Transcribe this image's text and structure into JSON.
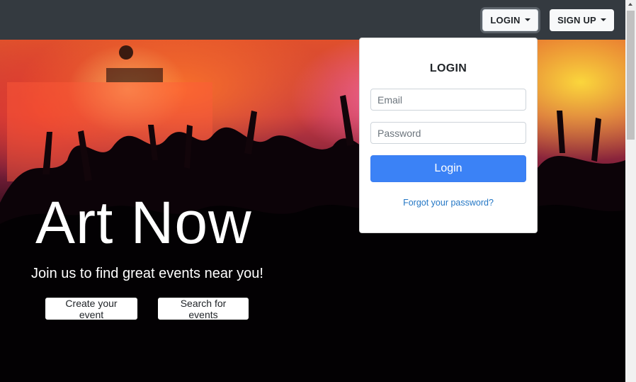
{
  "navbar": {
    "login_label": "LOGIN",
    "signup_label": "SIGN UP"
  },
  "hero": {
    "title": "Art Now",
    "subtitle": "Join us to find great events near you!",
    "create_label": "Create your event",
    "search_label": "Search for events"
  },
  "login_dropdown": {
    "title": "LOGIN",
    "email_placeholder": "Email",
    "password_placeholder": "Password",
    "submit_label": "Login",
    "forgot_label": "Forgot your password?"
  },
  "colors": {
    "navbar": "#343a40",
    "primary_button": "#3b82f6",
    "link": "#2477c5"
  },
  "icons": [
    "caret-down-icon",
    "scroll-up-arrow-icon"
  ]
}
